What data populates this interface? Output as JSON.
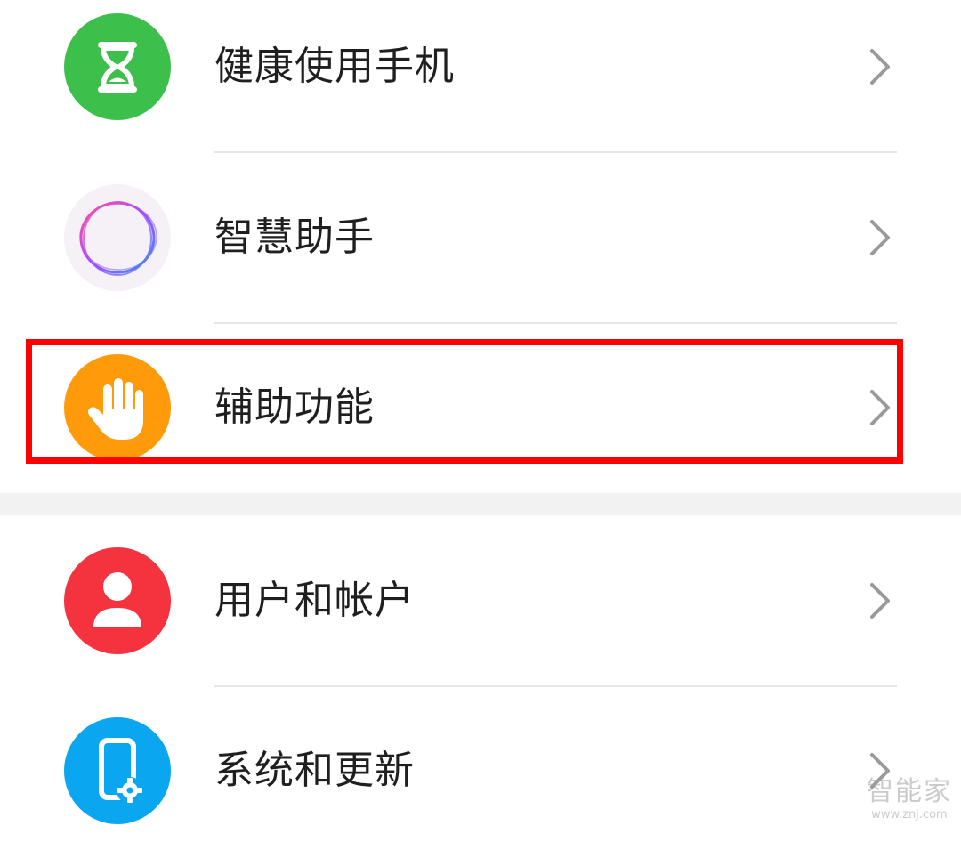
{
  "settings": {
    "items": [
      {
        "label": "健康使用手机",
        "icon": "hourglass-icon",
        "color": "#3dbf4c"
      },
      {
        "label": "智慧助手",
        "icon": "assistant-ring-icon",
        "color": "#f6f1f6"
      },
      {
        "label": "辅助功能",
        "icon": "hand-icon",
        "color": "#ff9a0a"
      },
      {
        "label": "用户和帐户",
        "icon": "person-icon",
        "color": "#f5333f"
      },
      {
        "label": "系统和更新",
        "icon": "phone-gear-icon",
        "color": "#0aa6f0"
      }
    ]
  },
  "annotation": {
    "highlight_color": "#ff0000"
  },
  "watermark": {
    "name": "智能家",
    "url": "www.znj.com"
  }
}
